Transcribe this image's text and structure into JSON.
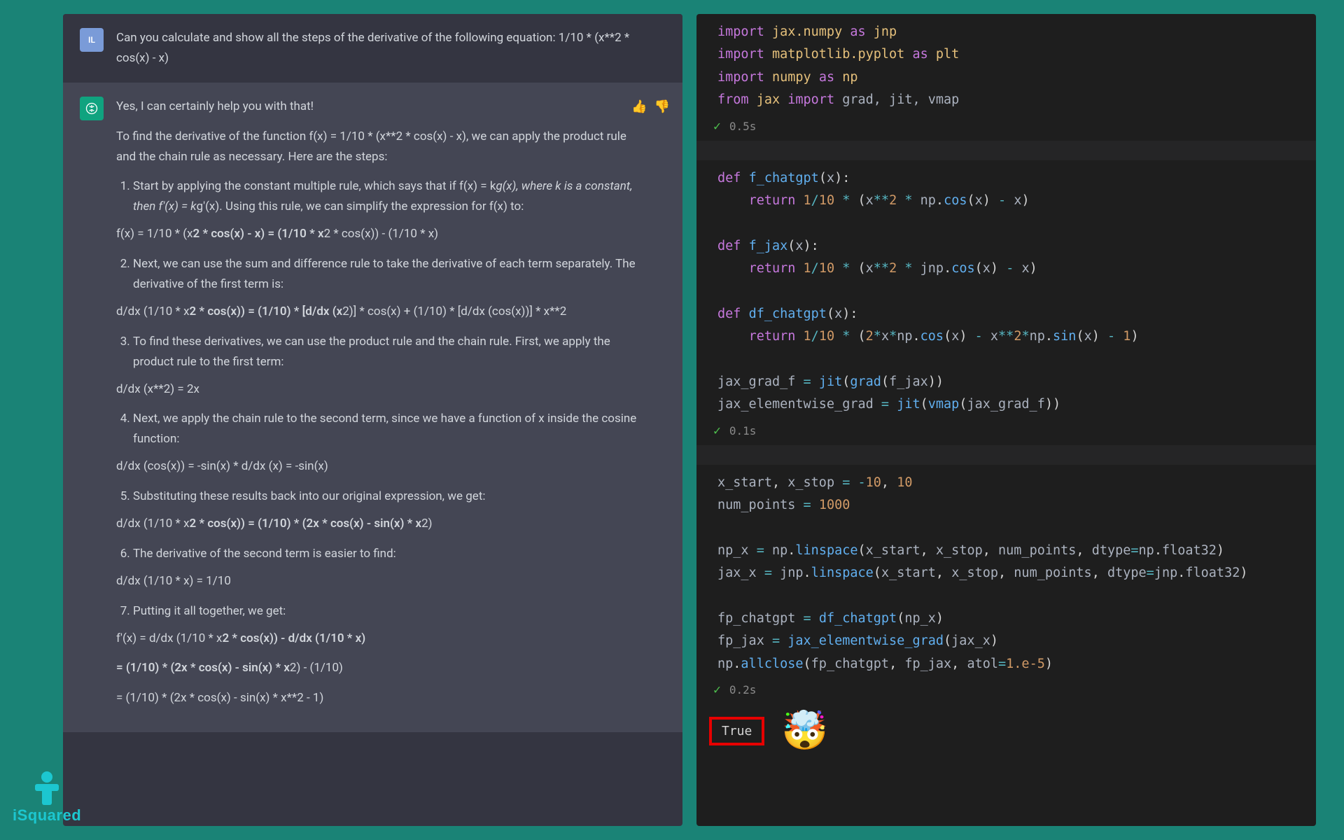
{
  "chat": {
    "user": {
      "avatar": "IL",
      "text": "Can you calculate and show all the steps of the derivative of the following equation: 1/10 * (x**2 * cos(x) - x)"
    },
    "assistant": {
      "intro": "Yes, I can certainly help you with that!",
      "para1": "To find the derivative of the function f(x) = 1/10 * (x**2 * cos(x) - x), we can apply the product rule and the chain rule as necessary. Here are the steps:",
      "step1a": "Start by applying the constant multiple rule, which says that if f(x) = k",
      "step1b": "g(x), where k is a constant, then f'(x) = k",
      "step1c": "g'(x). Using this rule, we can simplify the expression for f(x) to:",
      "eq1a": "f(x) = 1/10 * (x",
      "eq1b": "2 * cos(x) - x) = (1/10 * x",
      "eq1c": "2 * cos(x)) - (1/10 * x)",
      "step2": "Next, we can use the sum and difference rule to take the derivative of each term separately. The derivative of the first term is:",
      "eq2a": "d/dx (1/10 * x",
      "eq2b": "2 * cos(x)) = (1/10) * [d/dx (x",
      "eq2c": "2)] * cos(x) + (1/10) * [d/dx (cos(x))] * x**2",
      "step3": "To find these derivatives, we can use the product rule and the chain rule. First, we apply the product rule to the first term:",
      "eq3": "d/dx (x**2) = 2x",
      "step4": "Next, we apply the chain rule to the second term, since we have a function of x inside the cosine function:",
      "eq4": "d/dx (cos(x)) = -sin(x) * d/dx (x) = -sin(x)",
      "step5": "Substituting these results back into our original expression, we get:",
      "eq5a": "d/dx (1/10 * x",
      "eq5b": "2 * cos(x)) = (1/10) * (2x * cos(x) - sin(x) * x",
      "eq5c": "2)",
      "step6": "The derivative of the second term is easier to find:",
      "eq6": "d/dx (1/10 * x) = 1/10",
      "step7": "Putting it all together, we get:",
      "eq7a_1": "f'(x) = d/dx (1/10 * x",
      "eq7a_2": "2 * cos(x)) - d/dx (1/10 * x)",
      "eq7b_1": "= (1/10) * (2x * cos(x) - sin(x) * x",
      "eq7b_2": "2) - (1/10)",
      "eq7c": "= (1/10) * (2x * cos(x) - sin(x) * x**2 - 1)"
    }
  },
  "code": {
    "cell1": {
      "time": "0.5s"
    },
    "cell2": {
      "time": "0.1s"
    },
    "cell3": {
      "time": "0.2s",
      "output": "True",
      "emoji": "🤯"
    }
  },
  "logo": "iSquared"
}
